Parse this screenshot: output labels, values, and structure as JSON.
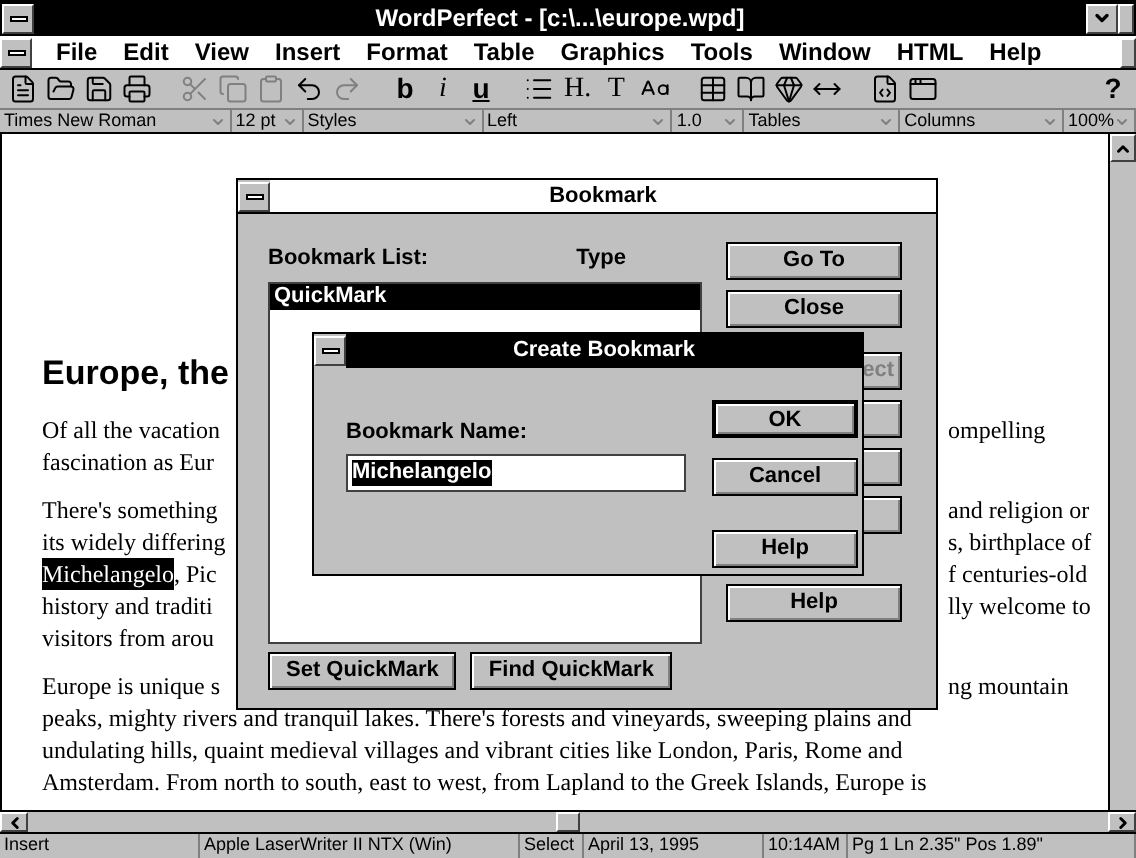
{
  "window": {
    "title": "WordPerfect - [c:\\...\\europe.wpd]"
  },
  "menu": [
    {
      "label": "File"
    },
    {
      "label": "Edit"
    },
    {
      "label": "View"
    },
    {
      "label": "Insert"
    },
    {
      "label": "Format"
    },
    {
      "label": "Table"
    },
    {
      "label": "Graphics"
    },
    {
      "label": "Tools"
    },
    {
      "label": "Window"
    },
    {
      "label": "HTML"
    },
    {
      "label": "Help"
    }
  ],
  "toolbar": [
    [
      {
        "kind": "icon",
        "disabled": false
      },
      {
        "kind": "icon",
        "disabled": false
      },
      {
        "kind": "icon",
        "disabled": false
      },
      {
        "kind": "icon",
        "disabled": false
      }
    ],
    [
      {
        "kind": "icon",
        "disabled": true
      },
      {
        "kind": "icon",
        "disabled": true
      },
      {
        "kind": "icon",
        "disabled": true
      },
      {
        "kind": "icon",
        "disabled": false
      },
      {
        "kind": "icon",
        "disabled": true
      }
    ],
    [
      {
        "kind": "text",
        "label": "b"
      },
      {
        "kind": "text",
        "label": "i"
      },
      {
        "kind": "text",
        "label": "u"
      }
    ],
    [
      {
        "kind": "icon",
        "disabled": false
      },
      {
        "kind": "text",
        "label": "H."
      },
      {
        "kind": "text",
        "label": "T"
      },
      {
        "kind": "icon",
        "disabled": false
      }
    ],
    [
      {
        "kind": "icon",
        "disabled": false
      },
      {
        "kind": "icon",
        "disabled": false
      },
      {
        "kind": "icon",
        "disabled": false
      },
      {
        "kind": "icon",
        "disabled": false
      }
    ],
    [
      {
        "kind": "icon",
        "disabled": false
      },
      {
        "kind": "icon",
        "disabled": false
      }
    ],
    [
      {
        "kind": "text",
        "label": "?"
      }
    ]
  ],
  "power_bar": [
    {
      "label": "Times New Roman"
    },
    {
      "label": "12 pt"
    },
    {
      "label": "Styles"
    },
    {
      "label": "Left"
    },
    {
      "label": "1.0"
    },
    {
      "label": "Tables"
    },
    {
      "label": "Columns"
    },
    {
      "label": "100%"
    }
  ],
  "document": {
    "heading": "Europe, the",
    "paragraphs": [
      [
        {
          "left": "Of all the vacation",
          "right": "ompelling"
        },
        {
          "left": "fascination as Eur"
        }
      ],
      [
        {
          "left": "There's something",
          "right": "and religion or"
        },
        {
          "left": "its widely differing",
          "right": "s, birthplace of"
        },
        {
          "segments": [
            {
              "text": "Michelangelo",
              "selected": true
            },
            {
              "text": ", Pic",
              "selected": false
            }
          ],
          "right": "f centuries-old"
        },
        {
          "left": "history and traditi",
          "right": "lly welcome to"
        },
        {
          "left": "visitors from arou"
        }
      ],
      [
        {
          "left": "Europe is unique s",
          "right": "ng mountain"
        },
        {
          "left": "peaks, mighty rivers and tranquil lakes.  There's forests and vineyards, sweeping plains and"
        },
        {
          "left": "undulating hills, quaint medieval villages and vibrant cities like London, Paris, Rome and"
        },
        {
          "left": "Amsterdam.  From north to south, east to west, from Lapland to the Greek Islands, Europe is"
        }
      ]
    ]
  },
  "bookmark_dialog": {
    "title": "Bookmark",
    "active": false,
    "list_label": "Bookmark List:",
    "type_label": "Type",
    "items": [
      {
        "name": "QuickMark",
        "selected": true
      }
    ],
    "buttons": [
      {
        "kind": "button",
        "label": "Go To"
      },
      {
        "kind": "button",
        "label": "Close"
      },
      {
        "kind": "button",
        "label": "ect"
      },
      {
        "kind": "covered"
      },
      {
        "kind": "covered"
      },
      {
        "kind": "covered"
      },
      {
        "kind": "button",
        "label": "Help"
      }
    ],
    "bottom_buttons": [
      {
        "label": "Set QuickMark"
      },
      {
        "label": "Find QuickMark"
      }
    ]
  },
  "create_dialog": {
    "title": "Create Bookmark",
    "active": true,
    "name_label": "Bookmark Name:",
    "name_value": "Michelangelo",
    "buttons": [
      {
        "label": "OK",
        "default": true
      },
      {
        "label": "Cancel",
        "default": false
      },
      {
        "label": "Help",
        "default": false
      }
    ]
  },
  "status_bar": [
    {
      "text": "Insert"
    },
    {
      "text": "Apple LaserWriter II NTX (Win)"
    },
    {
      "text": "Select"
    },
    {
      "text": "April 13, 1995"
    },
    {
      "text": "10:14AM"
    },
    {
      "text": "Pg 1 Ln 2.35\" Pos 1.89\""
    }
  ]
}
